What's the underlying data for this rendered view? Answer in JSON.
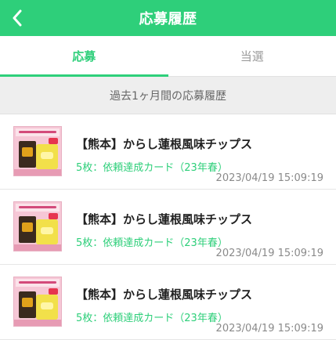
{
  "header": {
    "title": "応募履歴",
    "back_icon": "chevron-left-icon"
  },
  "tabs": [
    {
      "label": "応募",
      "active": true
    },
    {
      "label": "当選",
      "active": false
    }
  ],
  "section": {
    "label": "過去1ヶ月間の応募履歴"
  },
  "colors": {
    "accent": "#2ecf7a",
    "header_bg": "#2ecf7a",
    "section_bg": "#eeeeee"
  },
  "entries": [
    {
      "title": "【熊本】からし蓮根風味チップス",
      "cost": "5枚：依頼達成カード（23年春）",
      "date": "2023/04/19 15:09:19"
    },
    {
      "title": "【熊本】からし蓮根風味チップス",
      "cost": "5枚：依頼達成カード（23年春）",
      "date": "2023/04/19 15:09:19"
    },
    {
      "title": "【熊本】からし蓮根風味チップス",
      "cost": "5枚：依頼達成カード（23年春）",
      "date": "2023/04/19 15:09:19"
    }
  ]
}
